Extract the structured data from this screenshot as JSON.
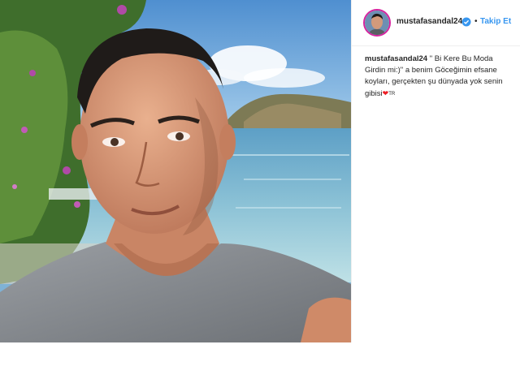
{
  "post": {
    "username": "mustafasandal24",
    "separator": "•",
    "follow_label": "Takip Et",
    "caption": {
      "username": "mustafasandal24",
      "text": " \" Bi Kere Bu Moda Girdin mi:)\" a benim Göceğimin efsane koyları, gerçekten şu dünyada yok senin gibisi",
      "emoji_heart": "❤",
      "emoji_flag_text": "TR"
    }
  },
  "colors": {
    "link_blue": "#3897f0",
    "text_dark": "#262626",
    "border": "#efefef",
    "heart_red": "#ed1c24"
  },
  "icons": {
    "verified": "verified-badge-icon"
  }
}
